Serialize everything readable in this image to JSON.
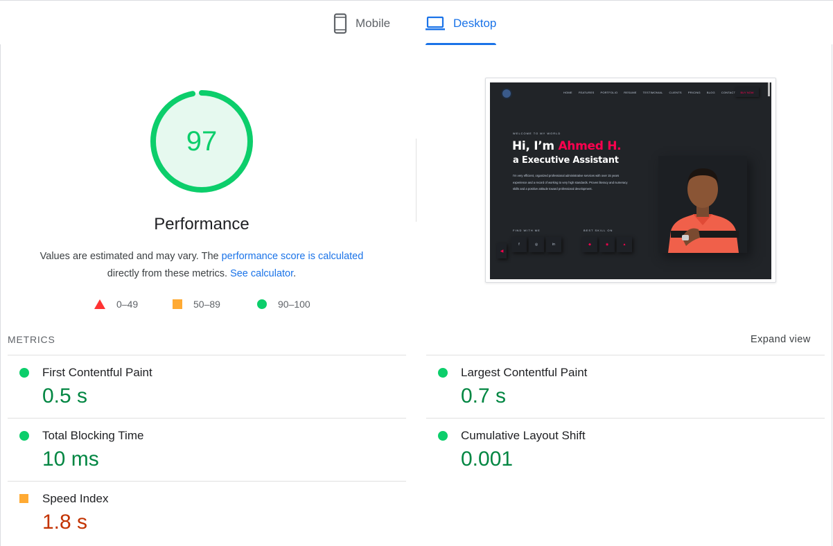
{
  "tabs": [
    {
      "label": "Mobile",
      "active": false,
      "icon": "phone-icon"
    },
    {
      "label": "Desktop",
      "active": true,
      "icon": "laptop-icon"
    }
  ],
  "performance": {
    "score": "97",
    "score_fraction": 0.97,
    "title": "Performance",
    "desc_prefix": "Values are estimated and may vary. The ",
    "desc_link": "performance score is calculated",
    "desc_middle": "directly from these metrics. ",
    "desc_link2": "See calculator",
    "desc_suffix": ".",
    "legend": [
      {
        "range": "0–49",
        "shape": "triangle",
        "color": "#ff3333"
      },
      {
        "range": "50–89",
        "shape": "square",
        "color": "#ffaa33"
      },
      {
        "range": "90–100",
        "shape": "circle",
        "color": "#0cce6b"
      }
    ]
  },
  "screenshot": {
    "nav": [
      "HOME",
      "FEATURES",
      "PORTFOLIO",
      "RESUME",
      "TESTIMONIAL",
      "CLIENTS",
      "PRICING",
      "BLOG",
      "CONTACTS"
    ],
    "buy_label": "BUY NOW",
    "welcome": "WELCOME TO MY WORLD",
    "greeting": "Hi, I’m ",
    "name": "Ahmed H.",
    "role": "a Executive Assistant",
    "paragraph": "I'm very efficient, organized professional administrative services with over 15 years experience and a record of working to very high standards. Proven literacy and numeracy skills and a positive attitude toward professional development.",
    "find_label": "FIND WITH ME",
    "skill_label": "BEST SKILL ON",
    "social_icons": [
      "f",
      "◎",
      "in"
    ],
    "skill_icons": [
      "◆",
      "◉",
      "▲"
    ]
  },
  "metrics": {
    "label": "METRICS",
    "expand": "Expand view",
    "items": [
      {
        "title": "First Contentful Paint",
        "value": "0.5 s",
        "rating": "pass"
      },
      {
        "title": "Largest Contentful Paint",
        "value": "0.7 s",
        "rating": "pass"
      },
      {
        "title": "Total Blocking Time",
        "value": "10 ms",
        "rating": "pass"
      },
      {
        "title": "Cumulative Layout Shift",
        "value": "0.001",
        "rating": "pass"
      },
      {
        "title": "Speed Index",
        "value": "1.8 s",
        "rating": "average"
      }
    ]
  },
  "colors": {
    "pass": "#0cce6b",
    "pass_text": "#018642",
    "average": "#ffaa33",
    "average_text": "#c33300",
    "fail": "#ff3333",
    "link": "#1a73e8",
    "accent_red": "#ff014f"
  }
}
